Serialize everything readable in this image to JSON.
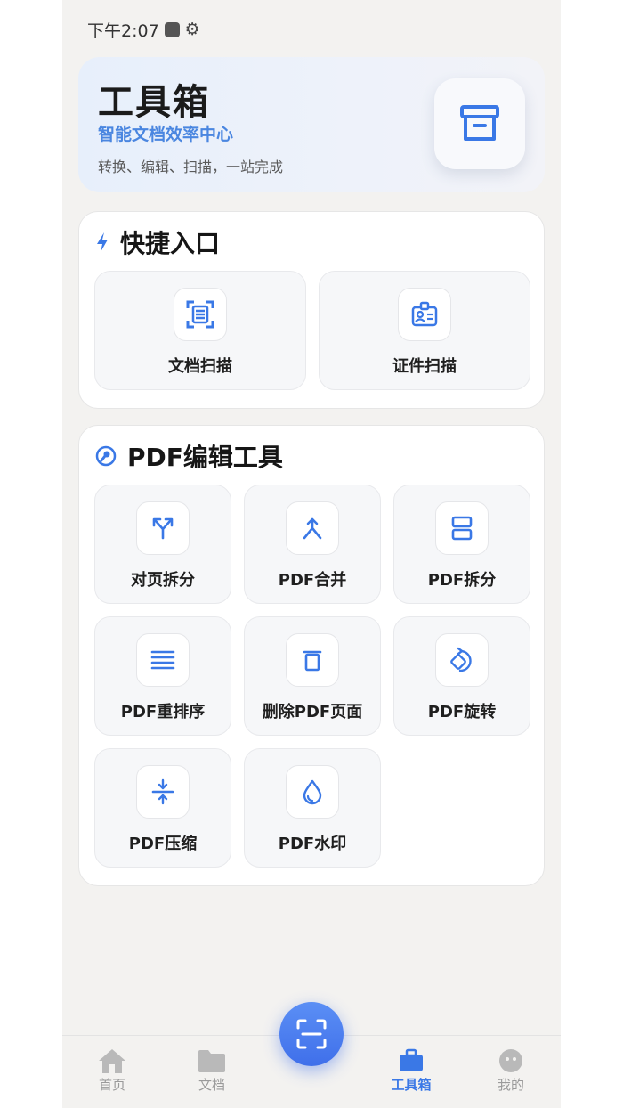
{
  "status_bar": {
    "time": "下午2:07"
  },
  "hero": {
    "title": "工具箱",
    "subtitle": "智能文档效率中心",
    "description": "转换、编辑、扫描，一站完成"
  },
  "quick": {
    "title": "快捷入口",
    "items": [
      {
        "label": "文档扫描",
        "icon": "document-scan-icon"
      },
      {
        "label": "证件扫描",
        "icon": "id-card-icon"
      }
    ]
  },
  "pdf_tools": {
    "title": "PDF编辑工具",
    "items": [
      {
        "label": "对页拆分",
        "icon": "split-arrows-icon"
      },
      {
        "label": "PDF合并",
        "icon": "merge-icon"
      },
      {
        "label": "PDF拆分",
        "icon": "split-pages-icon"
      },
      {
        "label": "PDF重排序",
        "icon": "reorder-icon"
      },
      {
        "label": "删除PDF页面",
        "icon": "trash-icon"
      },
      {
        "label": "PDF旋转",
        "icon": "rotate-icon"
      },
      {
        "label": "PDF压缩",
        "icon": "compress-icon"
      },
      {
        "label": "PDF水印",
        "icon": "watermark-drop-icon"
      }
    ]
  },
  "tabs": [
    {
      "label": "首页",
      "icon": "home-icon",
      "active": false
    },
    {
      "label": "文档",
      "icon": "folder-icon",
      "active": false
    },
    {
      "label": "工具箱",
      "icon": "toolbox-icon",
      "active": true
    },
    {
      "label": "我的",
      "icon": "profile-icon",
      "active": false
    }
  ],
  "colors": {
    "accent": "#4a86e0",
    "icon_blue": "#3a78e6",
    "background": "#f3f2f0"
  }
}
